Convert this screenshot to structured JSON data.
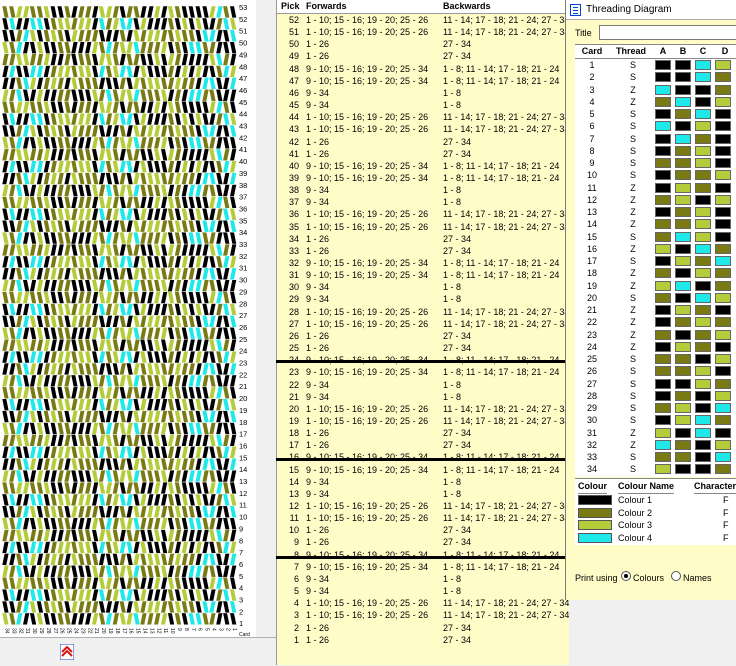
{
  "pattern": {
    "pick_labels": [
      "53",
      "52",
      "51",
      "50",
      "49",
      "48",
      "47",
      "46",
      "45",
      "44",
      "43",
      "42",
      "41",
      "40",
      "39",
      "38",
      "37",
      "36",
      "35",
      "34",
      "33",
      "32",
      "31",
      "30",
      "29",
      "28",
      "27",
      "26",
      "25",
      "24",
      "23",
      "22",
      "21",
      "20",
      "19",
      "18",
      "17",
      "16",
      "15",
      "14",
      "13",
      "12",
      "11",
      "10",
      "9",
      "8",
      "7",
      "6",
      "5",
      "4",
      "3",
      "2",
      "1"
    ],
    "footer_label": "Card",
    "card_numbers": [
      "34",
      "33",
      "32",
      "31",
      "30",
      "29",
      "28",
      "27",
      "26",
      "25",
      "24",
      "23",
      "22",
      "21",
      "20",
      "19",
      "18",
      "17",
      "16",
      "15",
      "14",
      "13",
      "12",
      "11",
      "10",
      "9",
      "8",
      "7",
      "6",
      "5",
      "4",
      "3",
      "2",
      "1"
    ]
  },
  "pick_table": {
    "headers": {
      "pick": "Pick",
      "forwards": "Forwards",
      "backwards": "Backwards"
    },
    "rows": [
      {
        "pick": "52",
        "forwards": "1 - 10; 15 - 16; 19 - 20; 25 - 26",
        "backwards": "11 - 14; 17 - 18; 21 - 24; 27 - 34"
      },
      {
        "pick": "51",
        "forwards": "1 - 10; 15 - 16; 19 - 20; 25 - 26",
        "backwards": "11 - 14; 17 - 18; 21 - 24; 27 - 34"
      },
      {
        "pick": "50",
        "forwards": "1 - 26",
        "backwards": "27 - 34"
      },
      {
        "pick": "49",
        "forwards": "1 - 26",
        "backwards": "27 - 34"
      },
      {
        "pick": "48",
        "forwards": "9 - 10; 15 - 16; 19 - 20; 25 - 34",
        "backwards": "1 - 8; 11 - 14; 17 - 18; 21 - 24"
      },
      {
        "pick": "47",
        "forwards": "9 - 10; 15 - 16; 19 - 20; 25 - 34",
        "backwards": "1 - 8; 11 - 14; 17 - 18; 21 - 24"
      },
      {
        "pick": "46",
        "forwards": "9 - 34",
        "backwards": "1 - 8"
      },
      {
        "pick": "45",
        "forwards": "9 - 34",
        "backwards": "1 - 8"
      },
      {
        "pick": "44",
        "forwards": "1 - 10; 15 - 16; 19 - 20; 25 - 26",
        "backwards": "11 - 14; 17 - 18; 21 - 24; 27 - 34"
      },
      {
        "pick": "43",
        "forwards": "1 - 10; 15 - 16; 19 - 20; 25 - 26",
        "backwards": "11 - 14; 17 - 18; 21 - 24; 27 - 34"
      },
      {
        "pick": "42",
        "forwards": "1 - 26",
        "backwards": "27 - 34"
      },
      {
        "pick": "41",
        "forwards": "1 - 26",
        "backwards": "27 - 34"
      },
      {
        "pick": "40",
        "forwards": "9 - 10; 15 - 16; 19 - 20; 25 - 34",
        "backwards": "1 - 8; 11 - 14; 17 - 18; 21 - 24"
      },
      {
        "pick": "39",
        "forwards": "9 - 10; 15 - 16; 19 - 20; 25 - 34",
        "backwards": "1 - 8; 11 - 14; 17 - 18; 21 - 24"
      },
      {
        "pick": "38",
        "forwards": "9 - 34",
        "backwards": "1 - 8"
      },
      {
        "pick": "37",
        "forwards": "9 - 34",
        "backwards": "1 - 8"
      },
      {
        "pick": "36",
        "forwards": "1 - 10; 15 - 16; 19 - 20; 25 - 26",
        "backwards": "11 - 14; 17 - 18; 21 - 24; 27 - 34"
      },
      {
        "pick": "35",
        "forwards": "1 - 10; 15 - 16; 19 - 20; 25 - 26",
        "backwards": "11 - 14; 17 - 18; 21 - 24; 27 - 34"
      },
      {
        "pick": "34",
        "forwards": "1 - 26",
        "backwards": "27 - 34"
      },
      {
        "pick": "33",
        "forwards": "1 - 26",
        "backwards": "27 - 34"
      },
      {
        "pick": "32",
        "forwards": "9 - 10; 15 - 16; 19 - 20; 25 - 34",
        "backwards": "1 - 8; 11 - 14; 17 - 18; 21 - 24"
      },
      {
        "pick": "31",
        "forwards": "9 - 10; 15 - 16; 19 - 20; 25 - 34",
        "backwards": "1 - 8; 11 - 14; 17 - 18; 21 - 24"
      },
      {
        "pick": "30",
        "forwards": "9 - 34",
        "backwards": "1 - 8"
      },
      {
        "pick": "29",
        "forwards": "9 - 34",
        "backwards": "1 - 8"
      },
      {
        "pick": "28",
        "forwards": "1 - 10; 15 - 16; 19 - 20; 25 - 26",
        "backwards": "11 - 14; 17 - 18; 21 - 24; 27 - 34"
      },
      {
        "pick": "27",
        "forwards": "1 - 10; 15 - 16; 19 - 20; 25 - 26",
        "backwards": "11 - 14; 17 - 18; 21 - 24; 27 - 34"
      },
      {
        "pick": "26",
        "forwards": "1 - 26",
        "backwards": "27 - 34"
      },
      {
        "pick": "25",
        "forwards": "1 - 26",
        "backwards": "27 - 34"
      },
      {
        "pick": "24",
        "forwards": "9 - 10; 15 - 16; 19 - 20; 25 - 34",
        "backwards": "1 - 8; 11 - 14; 17 - 18; 21 - 24"
      },
      {
        "pick": "23",
        "forwards": "9 - 10; 15 - 16; 19 - 20; 25 - 34",
        "backwards": "1 - 8; 11 - 14; 17 - 18; 21 - 24"
      },
      {
        "pick": "22",
        "forwards": "9 - 34",
        "backwards": "1 - 8"
      },
      {
        "pick": "21",
        "forwards": "9 - 34",
        "backwards": "1 - 8"
      },
      {
        "pick": "20",
        "forwards": "1 - 10; 15 - 16; 19 - 20; 25 - 26",
        "backwards": "11 - 14; 17 - 18; 21 - 24; 27 - 34"
      },
      {
        "pick": "19",
        "forwards": "1 - 10; 15 - 16; 19 - 20; 25 - 26",
        "backwards": "11 - 14; 17 - 18; 21 - 24; 27 - 34"
      },
      {
        "pick": "18",
        "forwards": "1 - 26",
        "backwards": "27 - 34"
      },
      {
        "pick": "17",
        "forwards": "1 - 26",
        "backwards": "27 - 34"
      },
      {
        "pick": "16",
        "forwards": "9 - 10; 15 - 16; 19 - 20; 25 - 34",
        "backwards": "1 - 8; 11 - 14; 17 - 18; 21 - 24"
      },
      {
        "pick": "15",
        "forwards": "9 - 10; 15 - 16; 19 - 20; 25 - 34",
        "backwards": "1 - 8; 11 - 14; 17 - 18; 21 - 24"
      },
      {
        "pick": "14",
        "forwards": "9 - 34",
        "backwards": "1 - 8"
      },
      {
        "pick": "13",
        "forwards": "9 - 34",
        "backwards": "1 - 8"
      },
      {
        "pick": "12",
        "forwards": "1 - 10; 15 - 16; 19 - 20; 25 - 26",
        "backwards": "11 - 14; 17 - 18; 21 - 24; 27 - 34"
      },
      {
        "pick": "11",
        "forwards": "1 - 10; 15 - 16; 19 - 20; 25 - 26",
        "backwards": "11 - 14; 17 - 18; 21 - 24; 27 - 34"
      },
      {
        "pick": "10",
        "forwards": "1 - 26",
        "backwards": "27 - 34"
      },
      {
        "pick": "9",
        "forwards": "1 - 26",
        "backwards": "27 - 34"
      },
      {
        "pick": "8",
        "forwards": "9 - 10; 15 - 16; 19 - 20; 25 - 34",
        "backwards": "1 - 8; 11 - 14; 17 - 18; 21 - 24"
      },
      {
        "pick": "7",
        "forwards": "9 - 10; 15 - 16; 19 - 20; 25 - 34",
        "backwards": "1 - 8; 11 - 14; 17 - 18; 21 - 24"
      },
      {
        "pick": "6",
        "forwards": "9 - 34",
        "backwards": "1 - 8"
      },
      {
        "pick": "5",
        "forwards": "9 - 34",
        "backwards": "1 - 8"
      },
      {
        "pick": "4",
        "forwards": "1 - 10; 15 - 16; 19 - 20; 25 - 26",
        "backwards": "11 - 14; 17 - 18; 21 - 24; 27 - 34"
      },
      {
        "pick": "3",
        "forwards": "1 - 10; 15 - 16; 19 - 20; 25 - 26",
        "backwards": "11 - 14; 17 - 18; 21 - 24; 27 - 34"
      },
      {
        "pick": "2",
        "forwards": "1 - 26",
        "backwards": "27 - 34"
      },
      {
        "pick": "1",
        "forwards": "1 - 26",
        "backwards": "27 - 34"
      }
    ]
  },
  "threading": {
    "window_title": "Threading Diagram",
    "title_label": "Title",
    "title_value": "",
    "headers": {
      "card": "Card",
      "thread": "Thread",
      "a": "A",
      "b": "B",
      "c": "C",
      "d": "D"
    },
    "rows": [
      {
        "card": "1",
        "thread": "S",
        "holes": [
          1,
          1,
          4,
          3
        ]
      },
      {
        "card": "2",
        "thread": "S",
        "holes": [
          1,
          1,
          4,
          2
        ]
      },
      {
        "card": "3",
        "thread": "Z",
        "holes": [
          4,
          1,
          1,
          2
        ]
      },
      {
        "card": "4",
        "thread": "Z",
        "holes": [
          2,
          4,
          1,
          3
        ]
      },
      {
        "card": "5",
        "thread": "S",
        "holes": [
          1,
          2,
          4,
          1
        ]
      },
      {
        "card": "6",
        "thread": "S",
        "holes": [
          4,
          1,
          3,
          1
        ]
      },
      {
        "card": "7",
        "thread": "S",
        "holes": [
          1,
          4,
          2,
          1
        ]
      },
      {
        "card": "8",
        "thread": "S",
        "holes": [
          1,
          2,
          3,
          1
        ]
      },
      {
        "card": "9",
        "thread": "S",
        "holes": [
          2,
          2,
          3,
          1
        ]
      },
      {
        "card": "10",
        "thread": "S",
        "holes": [
          1,
          2,
          2,
          3
        ]
      },
      {
        "card": "11",
        "thread": "Z",
        "holes": [
          1,
          3,
          2,
          1
        ]
      },
      {
        "card": "12",
        "thread": "Z",
        "holes": [
          2,
          3,
          1,
          3
        ]
      },
      {
        "card": "13",
        "thread": "Z",
        "holes": [
          1,
          2,
          3,
          1
        ]
      },
      {
        "card": "14",
        "thread": "Z",
        "holes": [
          2,
          2,
          3,
          1
        ]
      },
      {
        "card": "15",
        "thread": "S",
        "holes": [
          2,
          4,
          3,
          1
        ]
      },
      {
        "card": "16",
        "thread": "Z",
        "holes": [
          3,
          1,
          4,
          2
        ]
      },
      {
        "card": "17",
        "thread": "S",
        "holes": [
          1,
          3,
          2,
          4
        ]
      },
      {
        "card": "18",
        "thread": "Z",
        "holes": [
          2,
          1,
          3,
          2
        ]
      },
      {
        "card": "19",
        "thread": "Z",
        "holes": [
          3,
          4,
          1,
          2
        ]
      },
      {
        "card": "20",
        "thread": "S",
        "holes": [
          2,
          1,
          4,
          3
        ]
      },
      {
        "card": "21",
        "thread": "Z",
        "holes": [
          1,
          3,
          2,
          1
        ]
      },
      {
        "card": "22",
        "thread": "Z",
        "holes": [
          1,
          2,
          3,
          2
        ]
      },
      {
        "card": "23",
        "thread": "Z",
        "holes": [
          2,
          1,
          2,
          3
        ]
      },
      {
        "card": "24",
        "thread": "Z",
        "holes": [
          1,
          3,
          2,
          1
        ]
      },
      {
        "card": "25",
        "thread": "S",
        "holes": [
          2,
          2,
          1,
          3
        ]
      },
      {
        "card": "26",
        "thread": "S",
        "holes": [
          2,
          2,
          3,
          1
        ]
      },
      {
        "card": "27",
        "thread": "S",
        "holes": [
          1,
          1,
          3,
          2
        ]
      },
      {
        "card": "28",
        "thread": "S",
        "holes": [
          1,
          2,
          1,
          3
        ]
      },
      {
        "card": "29",
        "thread": "S",
        "holes": [
          2,
          3,
          1,
          4
        ]
      },
      {
        "card": "30",
        "thread": "S",
        "holes": [
          1,
          3,
          4,
          2
        ]
      },
      {
        "card": "31",
        "thread": "Z",
        "holes": [
          3,
          1,
          4,
          1
        ]
      },
      {
        "card": "32",
        "thread": "Z",
        "holes": [
          4,
          2,
          1,
          3
        ]
      },
      {
        "card": "33",
        "thread": "S",
        "holes": [
          2,
          2,
          1,
          4
        ]
      },
      {
        "card": "34",
        "thread": "S",
        "holes": [
          3,
          1,
          1,
          2
        ]
      }
    ],
    "colour_headers": {
      "colour": "Colour",
      "name": "Colour Name",
      "character": "Character"
    },
    "colours": [
      {
        "name": "Colour 1",
        "character": "F",
        "hex": "#000000"
      },
      {
        "name": "Colour 2",
        "character": "F",
        "hex": "#7a7a14"
      },
      {
        "name": "Colour 3",
        "character": "F",
        "hex": "#b5cc3a"
      },
      {
        "name": "Colour 4",
        "character": "F",
        "hex": "#1fe8e8"
      }
    ],
    "print_label": "Print using",
    "print_options": [
      {
        "label": "Colours",
        "selected": true
      },
      {
        "label": "Names",
        "selected": false
      }
    ]
  }
}
